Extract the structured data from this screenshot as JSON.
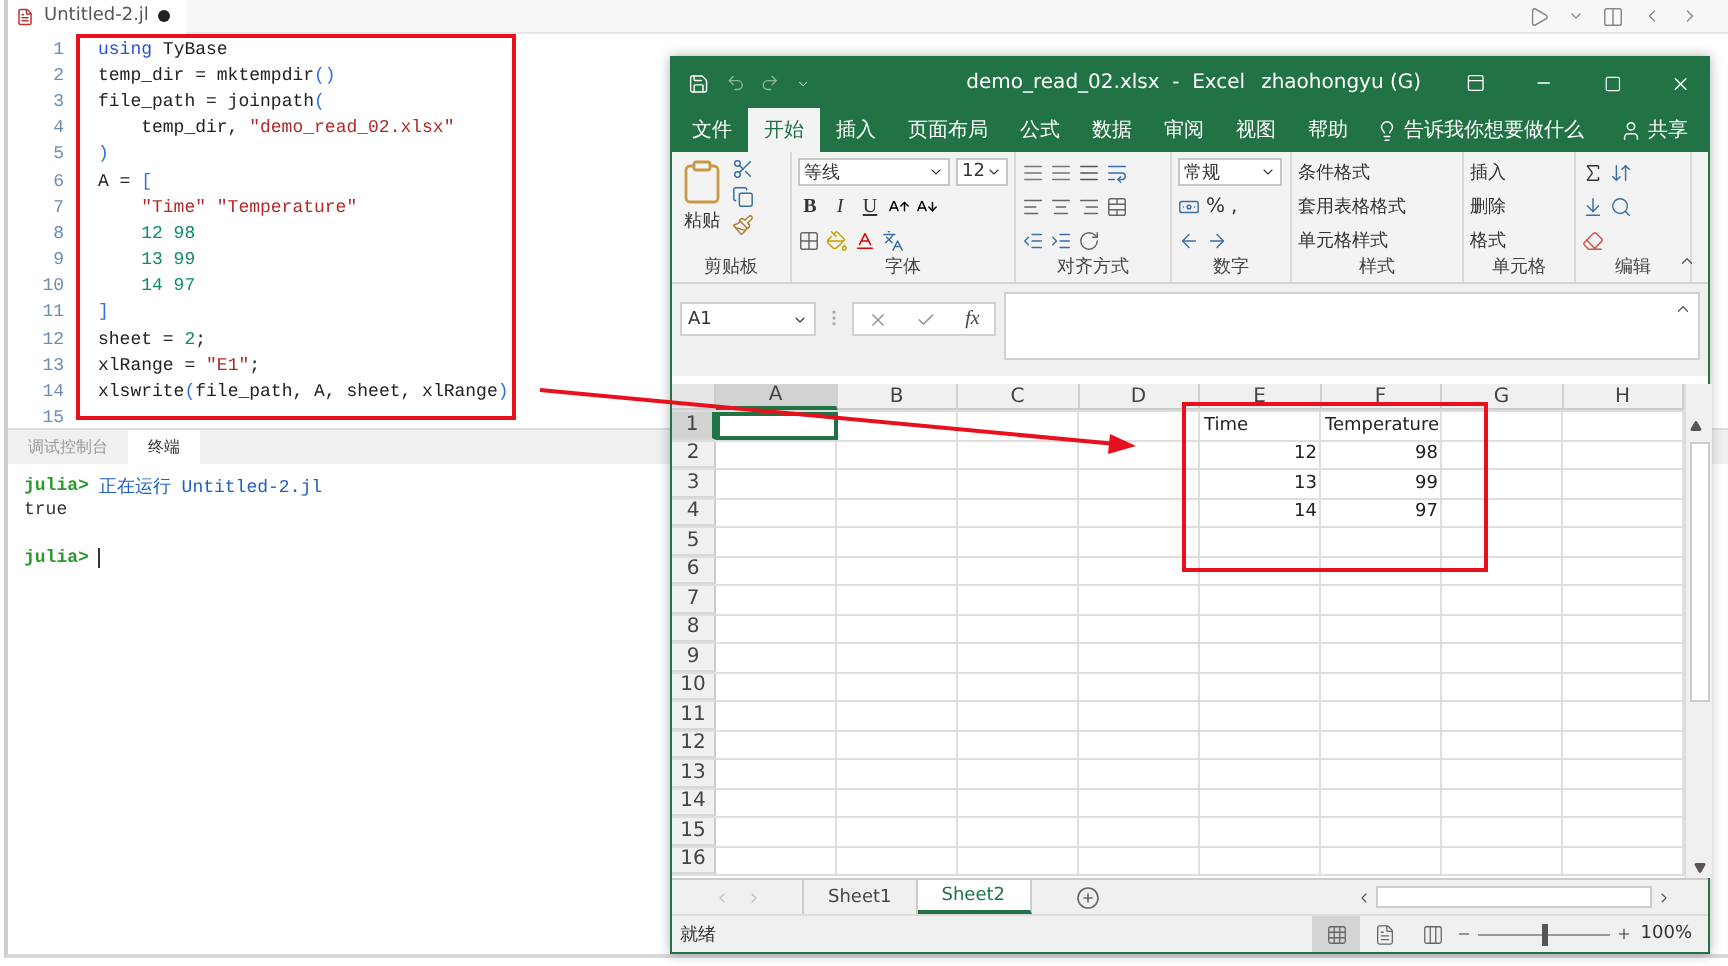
{
  "editor": {
    "tab": {
      "title": "Untitled-2.jl",
      "modified": true
    },
    "lines": [
      {
        "number": "1",
        "tokens": [
          {
            "kind": "keyword",
            "text": "using"
          },
          {
            "kind": "plain",
            "text": " TyBase"
          }
        ]
      },
      {
        "number": "2",
        "tokens": [
          {
            "kind": "plain",
            "text": "temp_dir = mktempdir"
          },
          {
            "kind": "punct",
            "text": "()"
          }
        ]
      },
      {
        "number": "3",
        "tokens": [
          {
            "kind": "plain",
            "text": "file_path = joinpath"
          },
          {
            "kind": "punct",
            "text": "("
          }
        ]
      },
      {
        "number": "4",
        "indented": true,
        "tokens": [
          {
            "kind": "plain",
            "text": "temp_dir, "
          },
          {
            "kind": "string",
            "text": "\"demo_read_02.xlsx\""
          }
        ]
      },
      {
        "number": "5",
        "tokens": [
          {
            "kind": "punct",
            "text": ")"
          }
        ]
      },
      {
        "number": "6",
        "tokens": [
          {
            "kind": "plain",
            "text": "A = "
          },
          {
            "kind": "punct",
            "text": "["
          }
        ]
      },
      {
        "number": "7",
        "indented": true,
        "tokens": [
          {
            "kind": "string",
            "text": "\"Time\""
          },
          {
            "kind": "string",
            "text": " \"Temperature\""
          }
        ]
      },
      {
        "number": "8",
        "indented": true,
        "tokens": [
          {
            "kind": "number",
            "text": "12 98"
          }
        ]
      },
      {
        "number": "9",
        "indented": true,
        "tokens": [
          {
            "kind": "number",
            "text": "13 99"
          }
        ]
      },
      {
        "number": "10",
        "indented": true,
        "tokens": [
          {
            "kind": "number",
            "text": "14 97"
          }
        ]
      },
      {
        "number": "11",
        "tokens": [
          {
            "kind": "punct",
            "text": "]"
          }
        ]
      },
      {
        "number": "12",
        "tokens": [
          {
            "kind": "plain",
            "text": "sheet = "
          },
          {
            "kind": "number",
            "text": "2"
          },
          {
            "kind": "plain",
            "text": ";"
          }
        ]
      },
      {
        "number": "13",
        "tokens": [
          {
            "kind": "plain",
            "text": "xlRange = "
          },
          {
            "kind": "string",
            "text": "\"E1\""
          },
          {
            "kind": "plain",
            "text": ";"
          }
        ]
      },
      {
        "number": "14",
        "tokens": [
          {
            "kind": "plain",
            "text": "xlswrite"
          },
          {
            "kind": "punct",
            "text": "("
          },
          {
            "kind": "plain",
            "text": "file_path, A, sheet, xlRange"
          },
          {
            "kind": "punct",
            "text": ")"
          }
        ]
      },
      {
        "number": "15"
      }
    ],
    "panel_tabs": [
      {
        "label": "调试控制台",
        "selected": false
      },
      {
        "label": "终端",
        "selected": true
      }
    ],
    "terminal": [
      {
        "kind": "prompt",
        "prompt": "julia>",
        "text": "正在运行 Untitled-2.jl"
      },
      {
        "kind": "output",
        "text": "true"
      },
      {
        "kind": "blank"
      },
      {
        "kind": "prompt",
        "prompt": "julia>",
        "cursor": true
      }
    ]
  },
  "excel": {
    "title": "demo_read_02.xlsx  -  Excel",
    "user": "zhaohongyu (G)",
    "menu_tabs": [
      {
        "label": "文件",
        "selected": false
      },
      {
        "label": "开始",
        "selected": true
      },
      {
        "label": "插入",
        "selected": false
      },
      {
        "label": "页面布局",
        "selected": false
      },
      {
        "label": "公式",
        "selected": false
      },
      {
        "label": "数据",
        "selected": false
      },
      {
        "label": "审阅",
        "selected": false
      },
      {
        "label": "视图",
        "selected": false
      },
      {
        "label": "帮助",
        "selected": false
      }
    ],
    "tell_me": "告诉我你想要做什么",
    "share": "共享",
    "ribbon": {
      "clipboard": {
        "paste": "粘贴",
        "label": "剪贴板"
      },
      "font": {
        "name": "等线",
        "size": "12",
        "styles": [
          "B",
          "I",
          "U"
        ],
        "label": "字体"
      },
      "alignment": {
        "label": "对齐方式"
      },
      "number": {
        "format": "常规",
        "symbols": [
          "%",
          ","
        ],
        "label": "数字"
      },
      "styles": {
        "commands": [
          "条件格式",
          "套用表格格式",
          "单元格样式"
        ],
        "label": "样式"
      },
      "cells": {
        "commands": [
          "插入",
          "删除",
          "格式"
        ],
        "label": "单元格"
      },
      "editing": {
        "label": "编辑"
      }
    },
    "name_box": "A1",
    "formula_symbol": "fx",
    "grid": {
      "columns": [
        "A",
        "B",
        "C",
        "D",
        "E",
        "F",
        "G",
        "H"
      ],
      "rows": [
        {
          "header": "1",
          "cells": [
            {
              "selected": true
            },
            {
              "selected": false
            },
            {
              "selected": false
            },
            {
              "selected": false
            },
            {
              "kind": "text",
              "text": "Time",
              "selected": false
            },
            {
              "kind": "text",
              "text": "Temperature",
              "selected": false
            },
            {
              "selected": false
            },
            {
              "selected": false
            }
          ]
        },
        {
          "header": "2",
          "cells": [
            {
              "selected": false
            },
            {
              "selected": false
            },
            {
              "selected": false
            },
            {
              "selected": false
            },
            {
              "kind": "number",
              "text": "12",
              "selected": false
            },
            {
              "kind": "number",
              "text": "98",
              "selected": false
            },
            {
              "selected": false
            },
            {
              "selected": false
            }
          ]
        },
        {
          "header": "3",
          "cells": [
            {
              "selected": false
            },
            {
              "selected": false
            },
            {
              "selected": false
            },
            {
              "selected": false
            },
            {
              "kind": "number",
              "text": "13",
              "selected": false
            },
            {
              "kind": "number",
              "text": "99",
              "selected": false
            },
            {
              "selected": false
            },
            {
              "selected": false
            }
          ]
        },
        {
          "header": "4",
          "cells": [
            {
              "selected": false
            },
            {
              "selected": false
            },
            {
              "selected": false
            },
            {
              "selected": false
            },
            {
              "kind": "number",
              "text": "14",
              "selected": false
            },
            {
              "kind": "number",
              "text": "97",
              "selected": false
            },
            {
              "selected": false
            },
            {
              "selected": false
            }
          ]
        },
        {
          "header": "5"
        },
        {
          "header": "6"
        },
        {
          "header": "7"
        },
        {
          "header": "8"
        },
        {
          "header": "9"
        },
        {
          "header": "10"
        },
        {
          "header": "11"
        },
        {
          "header": "12"
        },
        {
          "header": "13"
        },
        {
          "header": "14"
        },
        {
          "header": "15"
        },
        {
          "header": "16"
        }
      ]
    },
    "sheets": [
      {
        "label": "Sheet1",
        "selected": false
      },
      {
        "label": "Sheet2",
        "selected": true
      }
    ],
    "status": {
      "text": "就绪",
      "views": [
        {
          "kind": "normal",
          "selected": true
        },
        {
          "kind": "page_layout",
          "selected": false
        },
        {
          "kind": "page_break",
          "selected": false
        }
      ],
      "zoom": {
        "level": 0.5,
        "reading": "100%"
      }
    }
  }
}
